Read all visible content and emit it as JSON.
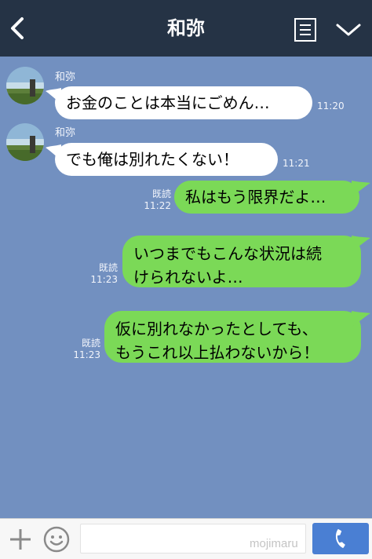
{
  "header": {
    "title": "和弥",
    "icons": {
      "back": "back-chevron-icon",
      "menu": "list-menu-icon",
      "collapse": "chevron-down-icon"
    }
  },
  "messages": [
    {
      "direction": "incoming",
      "sender": "和弥",
      "text": "お金のことは本当にごめん…",
      "time": "11:20"
    },
    {
      "direction": "incoming",
      "sender": "和弥",
      "text": "でも俺は別れたくない！",
      "time": "11:21"
    },
    {
      "direction": "outgoing",
      "read": "既読",
      "text": "私はもう限界だよ…",
      "time": "11:22"
    },
    {
      "direction": "outgoing",
      "read": "既読",
      "lines": [
        "いつまでもこんな状況は続",
        "けられないよ…"
      ],
      "time": "11:23"
    },
    {
      "direction": "outgoing",
      "read": "既読",
      "lines": [
        "仮に別れなかったとしても、",
        "もうこれ以上払わないから！"
      ],
      "time": "11:23"
    }
  ],
  "footer": {
    "input_placeholder": "",
    "watermark": "mojimaru",
    "icons": {
      "add": "plus-icon",
      "emoji": "smiley-icon",
      "call": "phone-icon"
    }
  },
  "colors": {
    "header_bg": "#253345",
    "chat_bg": "#7290c0",
    "incoming_bubble": "#ffffff",
    "outgoing_bubble": "#7bd957",
    "call_button": "#4a7fd3"
  }
}
